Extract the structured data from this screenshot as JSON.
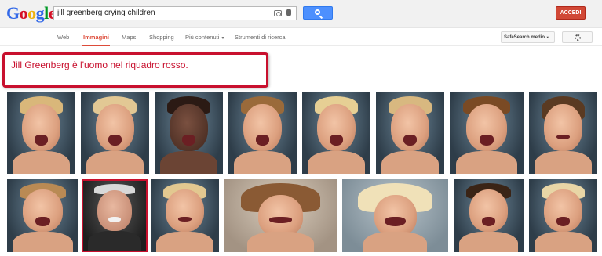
{
  "header": {
    "logo": [
      "G",
      "o",
      "o",
      "g",
      "l",
      "e"
    ],
    "logo_colors": [
      "#3369e8",
      "#d50f25",
      "#eeb211",
      "#3369e8",
      "#009925",
      "#d50f25"
    ],
    "search_query": "jill greenberg crying children",
    "signin_label": "ACCEDI"
  },
  "nav": {
    "tabs": [
      "Web",
      "Immagini",
      "Maps",
      "Shopping",
      "Più contenuti",
      "Strumenti di ricerca"
    ],
    "active_tab": "Immagini",
    "safesearch_label": "SafeSearch medio"
  },
  "annotation": {
    "text": "Jill Greenberg è l'uomo nel riquadro rosso.",
    "color": "#c8102e"
  },
  "results": {
    "highlighted_index": 9
  }
}
